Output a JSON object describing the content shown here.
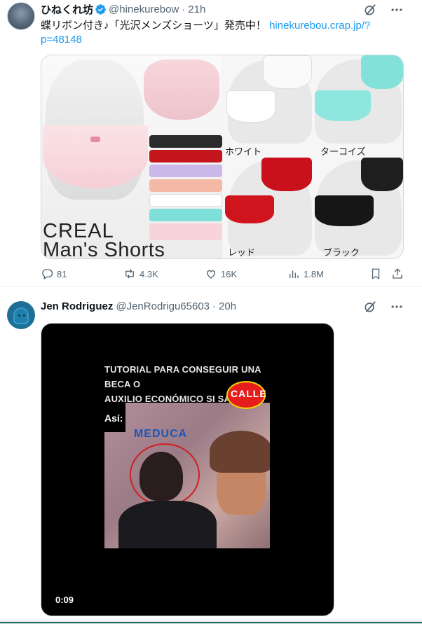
{
  "tweet1": {
    "display_name": "ひねくれ坊",
    "handle": "@hinekurebow",
    "separator": "·",
    "time": "21h",
    "text_line1": "蝶リボン付き♪「光沢メンズショーツ」発売中！ ",
    "link_part1": "hinekurebou.crap.jp/?",
    "link_part2": "p=48148",
    "media": {
      "brand_line1": "CREAL",
      "brand_line2": "Man's Shorts",
      "label_white": "ホワイト",
      "label_turquoise": "ターコイズ",
      "label_red": "レッド",
      "label_black": "ブラック"
    },
    "stats": {
      "replies": "81",
      "reposts": "4.3K",
      "likes": "16K",
      "views": "1.8M"
    }
  },
  "tweet2": {
    "display_name": "Jen Rodriguez",
    "handle": "@JenRodrigu65603",
    "separator": "·",
    "time": "20h",
    "video": {
      "title_line1": "TUTORIAL PARA CONSEGUIR UNA BECA O",
      "title_line2": "AUXILIO ECONÓMICO SI SALES EN",
      "overlay_asi": "Así:",
      "overlay_logo": "MEDUCA",
      "badge_text": "CALLE",
      "duration": "0:09"
    }
  },
  "colors": {
    "accent": "#1d9bf0",
    "text_primary": "#0f1419",
    "text_secondary": "#536471",
    "border": "#cfd9de",
    "verified": "#1d9bf0"
  },
  "icons": {
    "grok": "grok-icon",
    "more": "more-icon",
    "reply": "reply-icon",
    "repost": "repost-icon",
    "like": "like-icon",
    "views": "views-icon",
    "bookmark": "bookmark-icon",
    "share": "share-icon"
  }
}
